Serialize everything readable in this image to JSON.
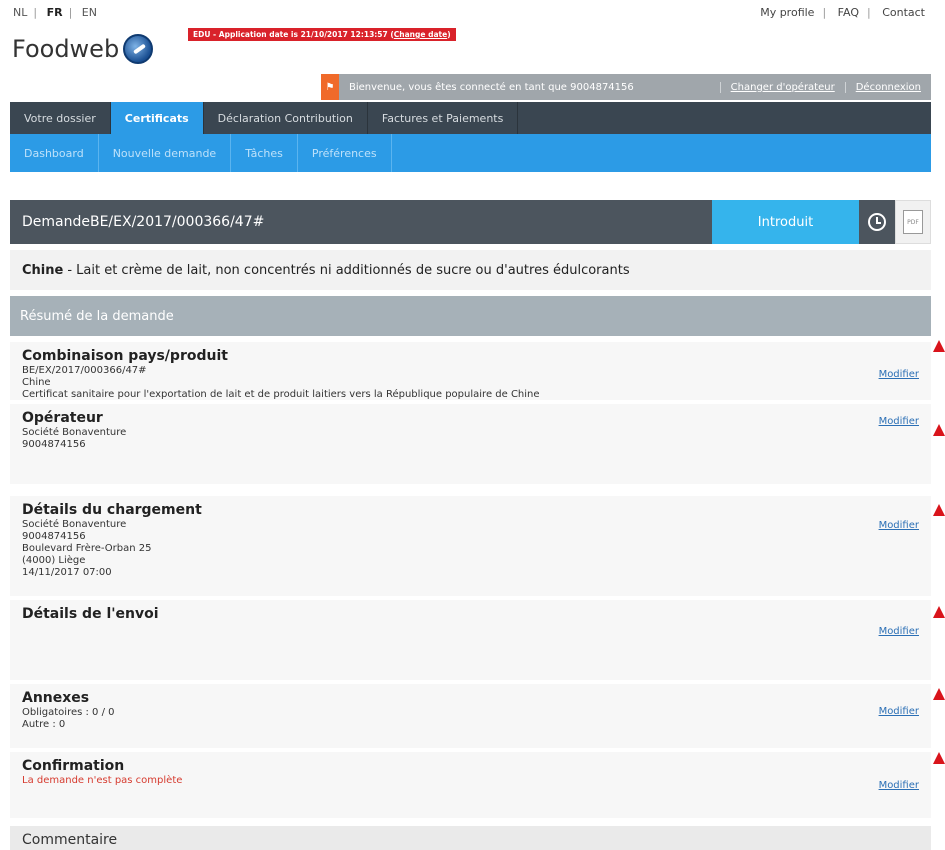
{
  "top": {
    "languages": [
      {
        "label": "NL",
        "selected": false
      },
      {
        "label": "FR",
        "selected": true
      },
      {
        "label": "EN",
        "selected": false
      }
    ],
    "links": [
      "My profile",
      "FAQ",
      "Contact"
    ]
  },
  "logo": {
    "text": "Foodweb"
  },
  "edu": {
    "prefix": "EDU - Application date is 21/10/2017 12:13:57 (",
    "link": "Change date",
    "suffix": ")"
  },
  "welcome": {
    "text": "Bienvenue, vous êtes connecté en tant que 9004874156",
    "change_operator": "Changer d'opérateur",
    "logout": "Déconnexion"
  },
  "mainnav": {
    "items": [
      "Votre dossier",
      "Certificats",
      "Déclaration Contribution",
      "Factures et Paiements"
    ],
    "active": 1
  },
  "subnav": {
    "items": [
      "Dashboard",
      "Nouvelle demande",
      "Tâches",
      "Préférences"
    ]
  },
  "request": {
    "title": "DemandeBE/EX/2017/000366/47#",
    "status": "Introduit",
    "pdf_label": "PDF"
  },
  "product": {
    "country": "Chine",
    "description": " - Lait et crème de lait, non concentrés ni additionnés de sucre ou d'autres édulcorants"
  },
  "summary": {
    "title": "Résumé de la demande"
  },
  "sections": {
    "combination": {
      "title": "Combinaison pays/produit",
      "lines": [
        "BE/EX/2017/000366/47#",
        "Chine",
        "Certificat sanitaire pour l'exportation de lait et de produit laitiers vers la République populaire de Chine"
      ],
      "modify": "Modifier"
    },
    "operator": {
      "title": "Opérateur",
      "lines": [
        "Société Bonaventure",
        "9004874156"
      ],
      "modify": "Modifier"
    },
    "loading": {
      "title": "Détails du chargement",
      "lines": [
        "Société Bonaventure",
        "9004874156",
        "Boulevard Frère-Orban 25",
        "(4000) Liège",
        "14/11/2017 07:00"
      ],
      "modify": "Modifier"
    },
    "shipment": {
      "title": "Détails de l'envoi",
      "modify": "Modifier"
    },
    "annexes": {
      "title": "Annexes",
      "lines": [
        "Obligatoires : 0 / 0",
        "Autre : 0"
      ],
      "modify": "Modifier"
    },
    "confirmation": {
      "title": "Confirmation",
      "warning": "La demande n'est pas complète",
      "modify": "Modifier"
    }
  },
  "comment": {
    "title": "Commentaire"
  },
  "colors": {
    "accent": "#2c9be6",
    "nav_dark": "#3a4651",
    "status": "#35b4ec",
    "warning": "#d9141b"
  }
}
